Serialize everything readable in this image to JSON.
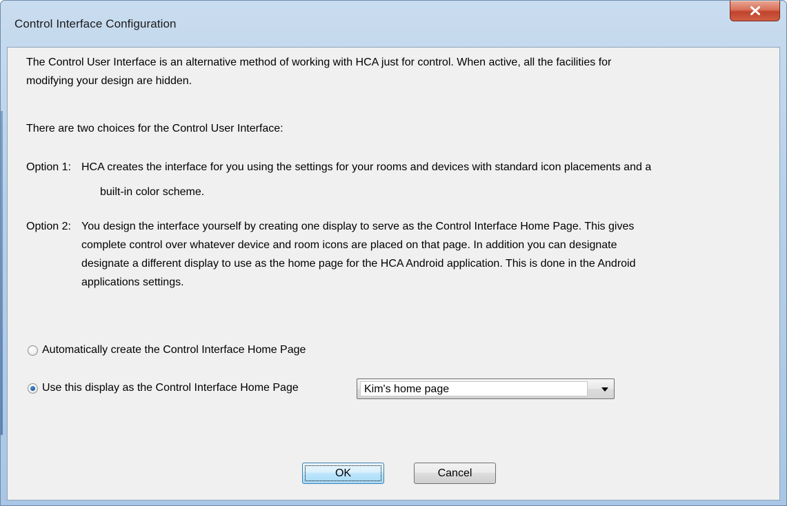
{
  "window": {
    "title": "Control Interface Configuration"
  },
  "body": {
    "intro_line1": "The Control User Interface is an alternative method of working with HCA just for control.  When active, all the facilities for",
    "intro_line2": "modifying your design are hidden.",
    "choices_heading": "There are two choices for the Control User Interface:",
    "option1_prefix": "Option 1:",
    "option1_line1": "HCA creates the interface for you using the settings for your rooms and devices with standard icon placements and a",
    "option1_line2": "built-in color scheme.",
    "option2_prefix": "Option 2:",
    "option2_line1": "You design the interface yourself by creating one display to serve as the Control Interface Home Page.  This gives",
    "option2_line2": "complete control over whatever device and room icons are placed on that page.  In addition you can designate",
    "option2_line3": "designate a different display to use as the home page for the HCA Android application.  This is done in the Android",
    "option2_line4": "applications settings."
  },
  "options": {
    "auto_label": "Automatically create the Control Interface Home Page",
    "auto_checked": false,
    "use_display_label": "Use this display as the Control Interface Home Page",
    "use_display_checked": true
  },
  "display_select": {
    "selected": "Kim's home page"
  },
  "buttons": {
    "ok": "OK",
    "cancel": "Cancel"
  },
  "icons": {
    "close": "close-icon",
    "dropdown": "chevron-down-icon"
  }
}
